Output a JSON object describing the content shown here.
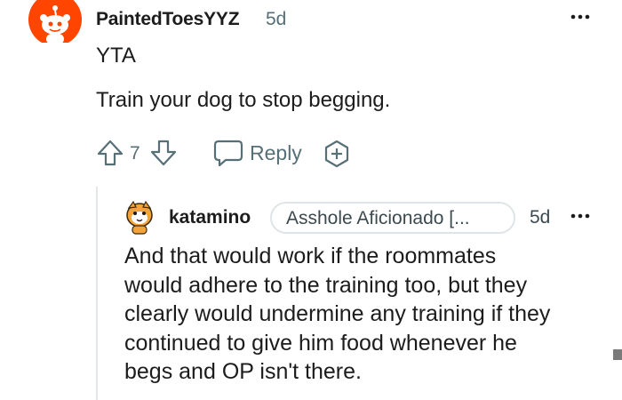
{
  "comment": {
    "author": "PaintedToesYYZ",
    "time": "5d",
    "body_lines": [
      "YTA",
      "Train your dog to stop begging."
    ],
    "score": "7",
    "reply_label": "Reply"
  },
  "reply": {
    "author": "katamino",
    "flair": "Asshole Aficionado [...",
    "time": "5d",
    "body_lines": [
      "And that would work if the roommates",
      "would adhere to the training too, but they",
      "clearly would undermine any training if they",
      "continued to give him food whenever he",
      "begs and OP isn't there."
    ]
  },
  "colors": {
    "brand_red": "#ff4500",
    "meta_gray": "#576f76",
    "text": "#1c1c1c"
  },
  "icons": {
    "upvote": "upvote-icon",
    "downvote": "downvote-icon",
    "reply": "speech-bubble-icon",
    "award": "award-plus-icon",
    "more": "more-options-icon"
  }
}
